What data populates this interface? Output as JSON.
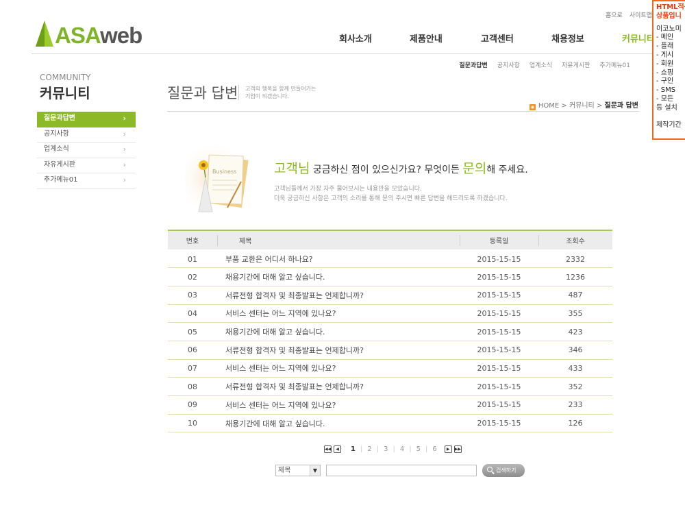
{
  "header": {
    "logo": {
      "part1": "ASA",
      "part2": "web"
    },
    "util_links": [
      "홈으로",
      "사이트맵"
    ],
    "gnb": [
      {
        "label": "회사소개"
      },
      {
        "label": "제품안내"
      },
      {
        "label": "고객센터"
      },
      {
        "label": "채용정보"
      },
      {
        "label": "커뮤니티",
        "active": true
      }
    ],
    "snb": [
      {
        "label": "질문과답변",
        "active": true
      },
      {
        "label": "공지사항"
      },
      {
        "label": "업계소식"
      },
      {
        "label": "자유게시판"
      },
      {
        "label": "추가메뉴01"
      }
    ]
  },
  "notice": {
    "title_lines": [
      "HTML적용",
      "상품입니"
    ],
    "lines": [
      "이코노미",
      " - 메인",
      " - 플래",
      " - 게시",
      " - 회원",
      " - 쇼핑",
      " - 구인",
      " - SMS",
      " - 모든",
      "등 설치",
      "",
      "제작기간"
    ]
  },
  "sidebar": {
    "title_en": "COMMUNITY",
    "title_ko": "커뮤니티",
    "items": [
      {
        "label": "질문과답변",
        "active": true
      },
      {
        "label": "공지사항"
      },
      {
        "label": "업계소식"
      },
      {
        "label": "자유게시판"
      },
      {
        "label": "추가메뉴01"
      }
    ],
    "arrow": "›"
  },
  "content": {
    "title": "질문과 답변",
    "desc_lines": [
      "고객의 행복을 함께 만들어가는",
      "기업이 되겠습니다."
    ],
    "breadcrumb": {
      "home": "HOME",
      "sep": ">",
      "mid": "커뮤니티",
      "current": "질문과 답변"
    },
    "intro": {
      "image_label": "Business",
      "head_g1": "고객님",
      "head_t1": " 궁금하신 점이 있으신가요? 무엇이든 ",
      "head_g2": "문의",
      "head_t2": "해 주세요.",
      "sub_lines": [
        "고객님들께서 가장 자주 물어보시는 내용만을 모았습니다.",
        "더욱 궁금하신 사항은 고객의 소리를 통해 문의 주시면 빠른 답변을 해드리도록 하겠습니다."
      ]
    },
    "table": {
      "headers": {
        "num": "번호",
        "title": "제목",
        "date": "등록일",
        "hits": "조회수"
      },
      "rows": [
        {
          "num": "01",
          "title": "부품 교환은 어디서 하나요?",
          "date": "2015-15-15",
          "hits": "2332"
        },
        {
          "num": "02",
          "title": "채용기간에 대해 알고 싶습니다.",
          "date": "2015-15-15",
          "hits": "1236"
        },
        {
          "num": "03",
          "title": "서류전형 합격자 및 최종발표는 언제합니까?",
          "date": "2015-15-15",
          "hits": "487"
        },
        {
          "num": "04",
          "title": "서비스 센터는 어느 지역에 있나요?",
          "date": "2015-15-15",
          "hits": "355"
        },
        {
          "num": "05",
          "title": "채용기간에 대해 알고 싶습니다.",
          "date": "2015-15-15",
          "hits": "423"
        },
        {
          "num": "06",
          "title": "서류전형 합격자 및 최종발표는 언제합니까?",
          "date": "2015-15-15",
          "hits": "346"
        },
        {
          "num": "07",
          "title": "서비스 센터는 어느 지역에 있나요?",
          "date": "2015-15-15",
          "hits": "433"
        },
        {
          "num": "08",
          "title": "서류전형 합격자 및 최종발표는 언제합니까?",
          "date": "2015-15-15",
          "hits": "352"
        },
        {
          "num": "09",
          "title": "서비스 센터는 어느 지역에 있나요?",
          "date": "2015-15-15",
          "hits": "233"
        },
        {
          "num": "10",
          "title": "채용기간에 대해 알고 싶습니다.",
          "date": "2015-15-15",
          "hits": "126"
        }
      ]
    },
    "paging": {
      "pages": [
        "1",
        "2",
        "3",
        "4",
        "5",
        "6"
      ],
      "current": "1",
      "first_icon": "first-page-icon",
      "prev_icon": "prev-page-icon",
      "next_icon": "next-page-icon",
      "last_icon": "last-page-icon"
    },
    "search": {
      "select_value": "제목",
      "input_value": "",
      "button_label": "검색하기"
    }
  },
  "colors": {
    "accent": "#8cb927",
    "notice_border": "#f06a1c",
    "rss": "#f39422"
  }
}
